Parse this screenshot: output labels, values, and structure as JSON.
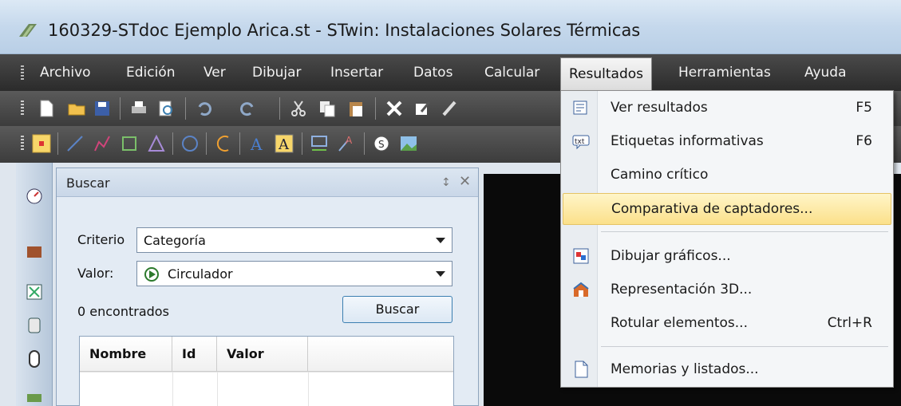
{
  "window": {
    "title": "160329-STdoc Ejemplo Arica.st - STwin: Instalaciones Solares Térmicas"
  },
  "menubar": {
    "items": [
      "Archivo",
      "Edición",
      "Ver",
      "Dibujar",
      "Insertar",
      "Datos",
      "Calcular",
      "Resultados",
      "Herramientas",
      "Ayuda"
    ],
    "active": "Resultados"
  },
  "results_menu": {
    "items": [
      {
        "label": "Ver resultados",
        "shortcut": "F5",
        "icon": "results-table-icon"
      },
      {
        "label": "Etiquetas informativas",
        "shortcut": "F6",
        "icon": "txt-label-icon"
      },
      {
        "label": "Camino crítico",
        "shortcut": "",
        "icon": ""
      },
      {
        "label": "Comparativa de captadores...",
        "shortcut": "",
        "icon": ""
      },
      {
        "label": "Dibujar gráficos...",
        "shortcut": "",
        "icon": "chart-icon"
      },
      {
        "label": "Representación 3D...",
        "shortcut": "",
        "icon": "house-3d-icon"
      },
      {
        "label": "Rotular elementos...",
        "shortcut": "Ctrl+R",
        "icon": ""
      },
      {
        "label": "Memorias y listados...",
        "shortcut": "",
        "icon": "document-icon"
      }
    ],
    "highlighted": "Comparativa de captadores..."
  },
  "search_panel": {
    "title": "Buscar",
    "criterio_label": "Criterio",
    "criterio_value": "Categoría",
    "valor_label": "Valor:",
    "valor_value": "Circulador",
    "found_text": "0 encontrados",
    "search_button": "Buscar",
    "columns": [
      "Nombre",
      "Id",
      "Valor"
    ]
  },
  "colors": {
    "menubar_bg": "#2b2b2b",
    "highlight": "#fbe08a",
    "canvas_bg": "#0a0a0a"
  }
}
